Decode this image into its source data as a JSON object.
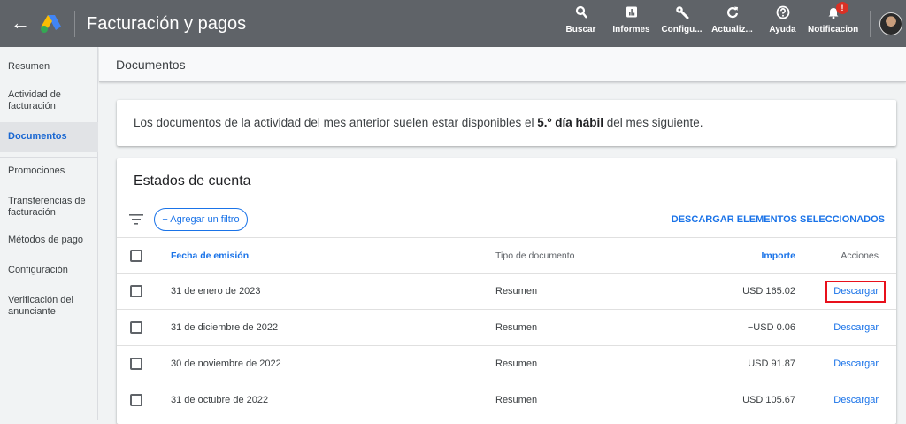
{
  "header": {
    "back_icon": "arrow-left-icon",
    "logo": "google-ads-logo",
    "title": "Facturación y pagos",
    "tools": [
      {
        "icon": "search-icon",
        "label": "Buscar"
      },
      {
        "icon": "chart-icon",
        "label": "Informes"
      },
      {
        "icon": "wrench-icon",
        "label": "Configu..."
      },
      {
        "icon": "refresh-icon",
        "label": "Actualiz..."
      },
      {
        "icon": "help-icon",
        "label": "Ayuda"
      },
      {
        "icon": "bell-icon",
        "label": "Notificacion es",
        "badge": "!"
      }
    ]
  },
  "sidebar": {
    "items": [
      {
        "label": "Resumen"
      },
      {
        "label": "Actividad de facturación"
      },
      {
        "label": "Documentos",
        "active": true
      },
      {
        "label": "Promociones"
      },
      {
        "label": "Transferencias de facturación"
      },
      {
        "label": "Métodos de pago"
      },
      {
        "label": "Configuración"
      },
      {
        "label": "Verificación del anunciante"
      }
    ]
  },
  "page": {
    "title": "Documentos",
    "notice_pre": "Los documentos de la actividad del mes anterior suelen estar disponibles el ",
    "notice_bold": "5.º día hábil",
    "notice_post": " del mes siguiente."
  },
  "statements": {
    "title": "Estados de cuenta",
    "filter_button": "+ Agregar un filtro",
    "download_selected": "DESCARGAR ELEMENTOS SELECCIONADOS",
    "columns": {
      "date": "Fecha de emisión",
      "type": "Tipo de documento",
      "amount": "Importe",
      "actions": "Acciones"
    },
    "rows": [
      {
        "date": "31 de enero de 2023",
        "type": "Resumen",
        "amount": "USD 165.02",
        "action": "Descargar",
        "highlighted": true
      },
      {
        "date": "31 de diciembre de 2022",
        "type": "Resumen",
        "amount": "−USD 0.06",
        "action": "Descargar"
      },
      {
        "date": "30 de noviembre de 2022",
        "type": "Resumen",
        "amount": "USD 91.87",
        "action": "Descargar"
      },
      {
        "date": "31 de octubre de 2022",
        "type": "Resumen",
        "amount": "USD 105.67",
        "action": "Descargar"
      }
    ]
  },
  "colors": {
    "topbar": "#5f6368",
    "accent": "#1a73e8",
    "highlight": "#e8101b"
  }
}
